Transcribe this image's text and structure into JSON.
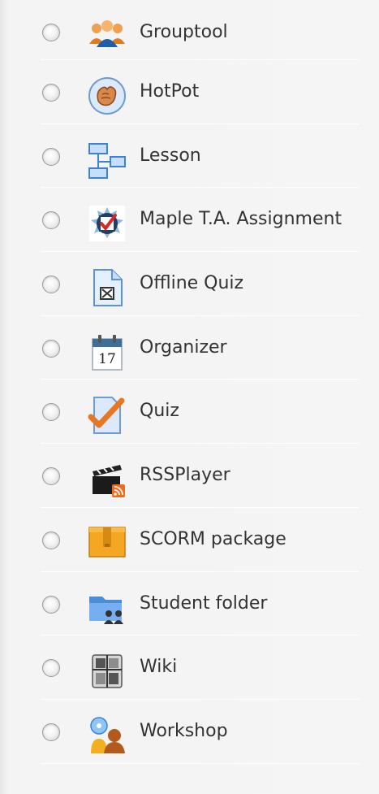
{
  "activities": [
    {
      "label": "Grouptool",
      "icon": "grouptool-icon"
    },
    {
      "label": "HotPot",
      "icon": "hotpot-icon"
    },
    {
      "label": "Lesson",
      "icon": "lesson-icon"
    },
    {
      "label": "Maple T.A. Assignment",
      "icon": "maple-ta-icon"
    },
    {
      "label": "Offline Quiz",
      "icon": "offline-quiz-icon"
    },
    {
      "label": "Organizer",
      "icon": "organizer-icon"
    },
    {
      "label": "Quiz",
      "icon": "quiz-icon"
    },
    {
      "label": "RSSPlayer",
      "icon": "rssplayer-icon"
    },
    {
      "label": "SCORM package",
      "icon": "scorm-package-icon"
    },
    {
      "label": "Student folder",
      "icon": "student-folder-icon"
    },
    {
      "label": "Wiki",
      "icon": "wiki-icon"
    },
    {
      "label": "Workshop",
      "icon": "workshop-icon"
    }
  ],
  "organizer_day": "17",
  "colors": {
    "label_text": "#333333",
    "separator": "#ffffff",
    "panel_bg": "#f5f5f5"
  }
}
